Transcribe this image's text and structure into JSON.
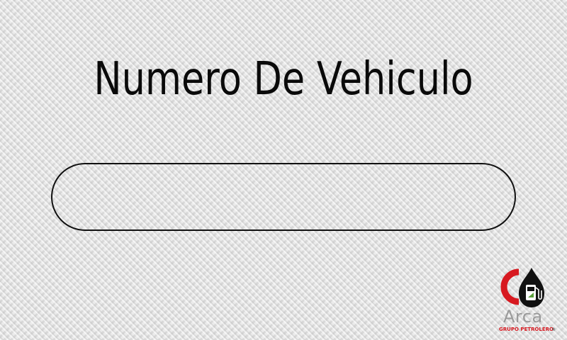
{
  "prompt": {
    "title": "Numero De Vehiculo"
  },
  "vehicle_input": {
    "value": "",
    "placeholder": ""
  },
  "brand": {
    "name": "Arca",
    "tagline": "GRUPO PETROLERO",
    "registered_mark": "®",
    "icon": "fuel-pump-drop-icon",
    "colors": {
      "red": "#d71920",
      "black": "#111111",
      "gray": "#9a9a9a",
      "green": "#5a9e3a"
    }
  }
}
